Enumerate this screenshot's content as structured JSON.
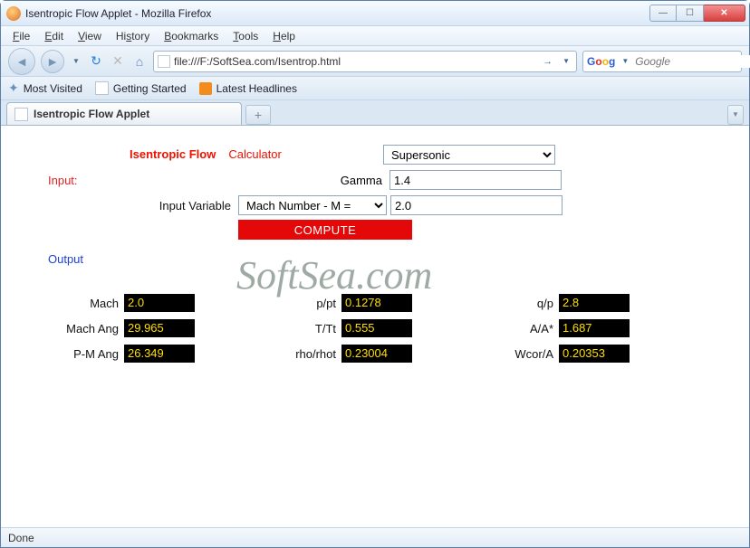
{
  "window": {
    "title": "Isentropic Flow Applet - Mozilla Firefox"
  },
  "menu": {
    "file": "File",
    "edit": "Edit",
    "view": "View",
    "history": "History",
    "bookmarks": "Bookmarks",
    "tools": "Tools",
    "help": "Help"
  },
  "nav": {
    "url": "file:///F:/SoftSea.com/Isentrop.html",
    "search_placeholder": "Google"
  },
  "bookmarks": {
    "most_visited": "Most Visited",
    "getting_started": "Getting Started",
    "latest_headlines": "Latest Headlines"
  },
  "tab": {
    "title": "Isentropic Flow Applet",
    "new": "+"
  },
  "applet": {
    "heading_a": "Isentropic Flow",
    "heading_b": "Calculator",
    "input_label": "Input:",
    "output_label": "Output",
    "mode": "Supersonic",
    "gamma_label": "Gamma",
    "gamma_value": "1.4",
    "ivar_label": "Input Variable",
    "ivar_select": "Mach Number - M =",
    "ivar_value": "2.0",
    "compute": "COMPUTE",
    "outputs": {
      "col1": [
        {
          "label": "Mach",
          "value": "2.0"
        },
        {
          "label": "Mach Ang",
          "value": "29.965"
        },
        {
          "label": "P-M Ang",
          "value": "26.349"
        }
      ],
      "col2": [
        {
          "label": "p/pt",
          "value": "0.1278"
        },
        {
          "label": "T/Tt",
          "value": "0.555"
        },
        {
          "label": "rho/rhot",
          "value": "0.23004"
        }
      ],
      "col3": [
        {
          "label": "q/p",
          "value": "2.8"
        },
        {
          "label": "A/A*",
          "value": "1.687"
        },
        {
          "label": "Wcor/A",
          "value": "0.20353"
        }
      ]
    }
  },
  "watermark": "SoftSea.com",
  "status": "Done"
}
